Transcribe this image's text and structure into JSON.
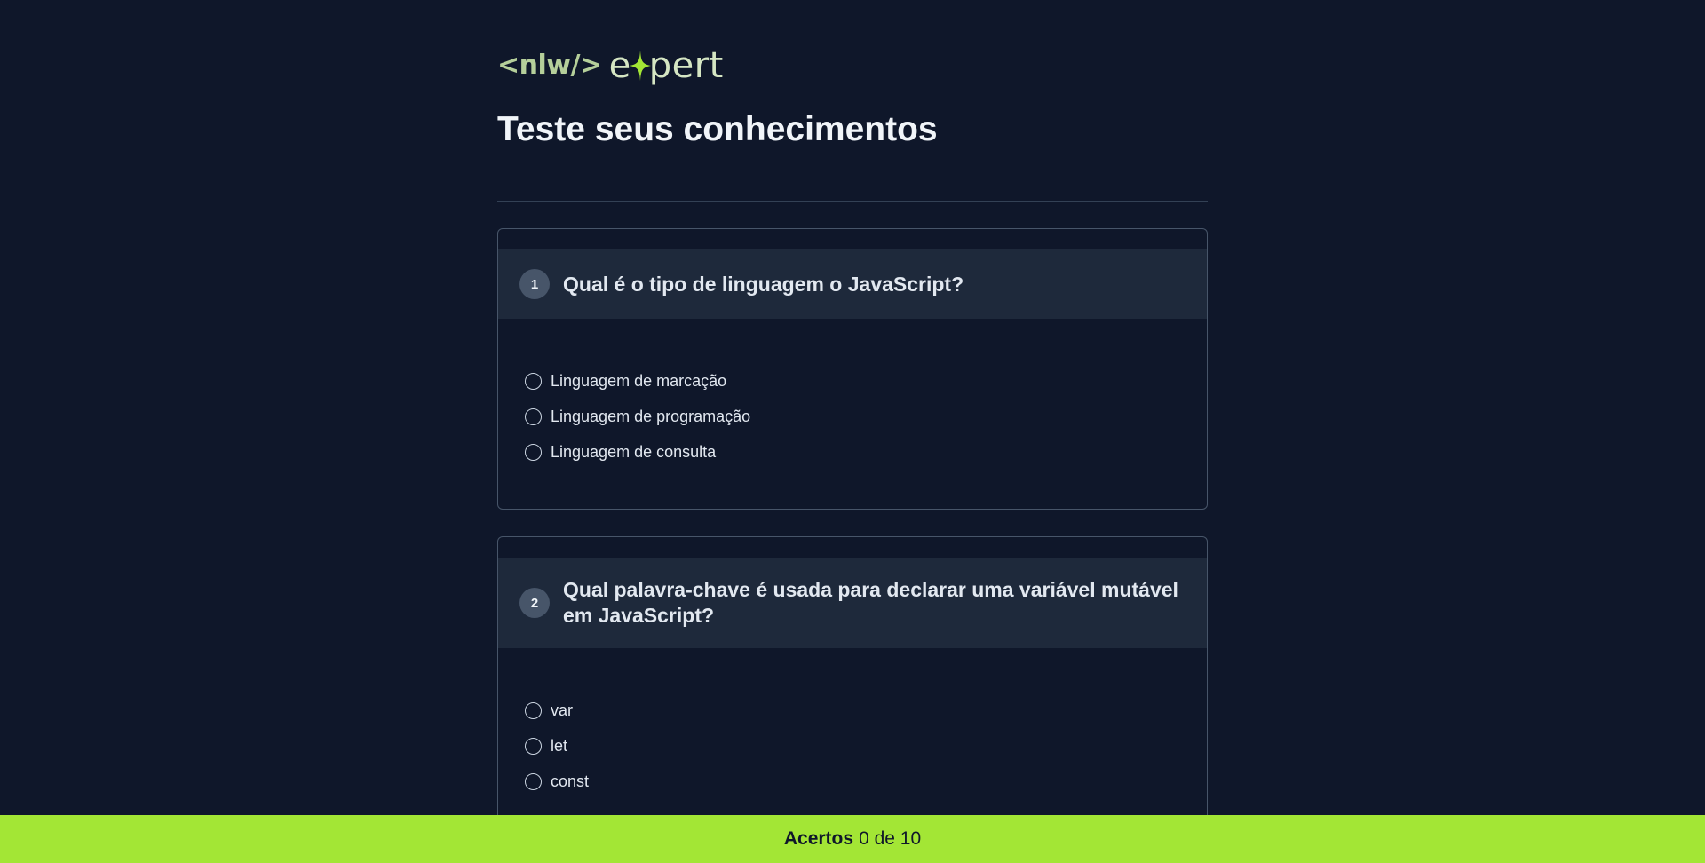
{
  "logo": {
    "nlw_text": "<nlw/>",
    "expert_prefix": "e",
    "expert_suffix": "pert",
    "colors": {
      "nlw": "#b5cf9a",
      "expert": "#d5e6c3",
      "star": "#a3e635"
    }
  },
  "page_title": "Teste seus conhecimentos",
  "questions": [
    {
      "number": "1",
      "text": "Qual é o tipo de linguagem o JavaScript?",
      "options": [
        "Linguagem de marcação",
        "Linguagem de programação",
        "Linguagem de consulta"
      ]
    },
    {
      "number": "2",
      "text": "Qual palavra-chave é usada para declarar uma variável mutável em JavaScript?",
      "options": [
        "var",
        "let",
        "const"
      ]
    }
  ],
  "footer": {
    "label": "Acertos",
    "score": "0 de 10"
  },
  "colors": {
    "background": "#0f172a",
    "card_header": "#1e293b",
    "accent": "#a3e635"
  }
}
